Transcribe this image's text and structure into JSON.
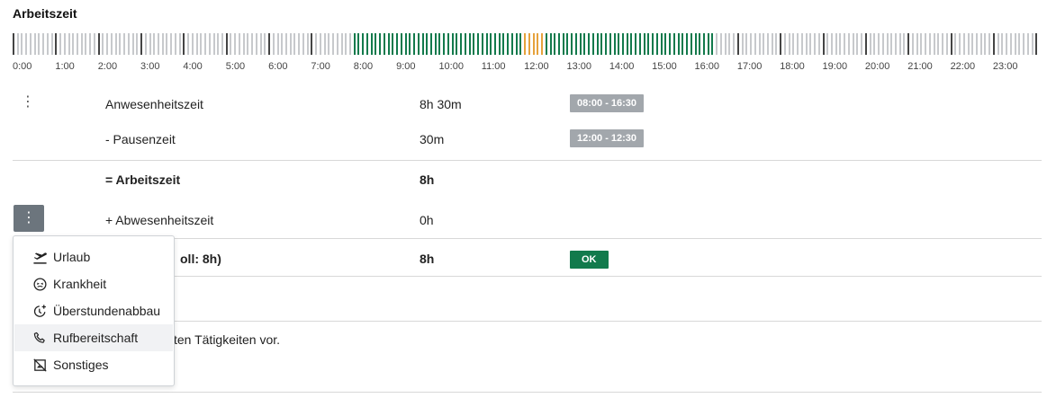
{
  "section": {
    "title": "Arbeitszeit"
  },
  "timeline": {
    "hours": [
      "0:00",
      "1:00",
      "2:00",
      "3:00",
      "4:00",
      "5:00",
      "6:00",
      "7:00",
      "8:00",
      "9:00",
      "10:00",
      "11:00",
      "12:00",
      "13:00",
      "14:00",
      "15:00",
      "16:00",
      "17:00",
      "18:00",
      "19:00",
      "20:00",
      "21:00",
      "22:00",
      "23:00"
    ],
    "presence": {
      "start_hour": 8.0,
      "end_hour": 16.5
    },
    "pause": {
      "start_hour": 12.0,
      "end_hour": 12.5
    },
    "colors": {
      "idle": "#c7c9cc",
      "hour_marker": "#444444",
      "work": "#127a4c",
      "pause": "#e6a23c"
    }
  },
  "rows": [
    {
      "label": "Anwesenheitszeit",
      "value": "8h 30m",
      "badge": "08:00 - 16:30"
    },
    {
      "label": "- Pausenzeit",
      "value": "30m",
      "badge": "12:00 - 12:30"
    },
    {
      "label": "= Arbeitszeit",
      "value": "8h"
    },
    {
      "label": "+ Abwesenheitszeit",
      "value": "0h"
    },
    {
      "label_visible": "oll: 8h)",
      "value": "8h",
      "badge": "OK"
    }
  ],
  "behind_text": {
    "line": "ten Tätigkeiten vor."
  },
  "menu": {
    "items": [
      {
        "label": "Urlaub",
        "icon": "airplane-departure-icon"
      },
      {
        "label": "Krankheit",
        "icon": "sick-face-icon"
      },
      {
        "label": "Überstundenabbau",
        "icon": "clock-plus-icon"
      },
      {
        "label": "Rufbereitschaft",
        "icon": "phone-icon"
      },
      {
        "label": "Sonstiges",
        "icon": "no-pictures-icon"
      }
    ]
  },
  "icons": {
    "kebab": "⋮"
  }
}
